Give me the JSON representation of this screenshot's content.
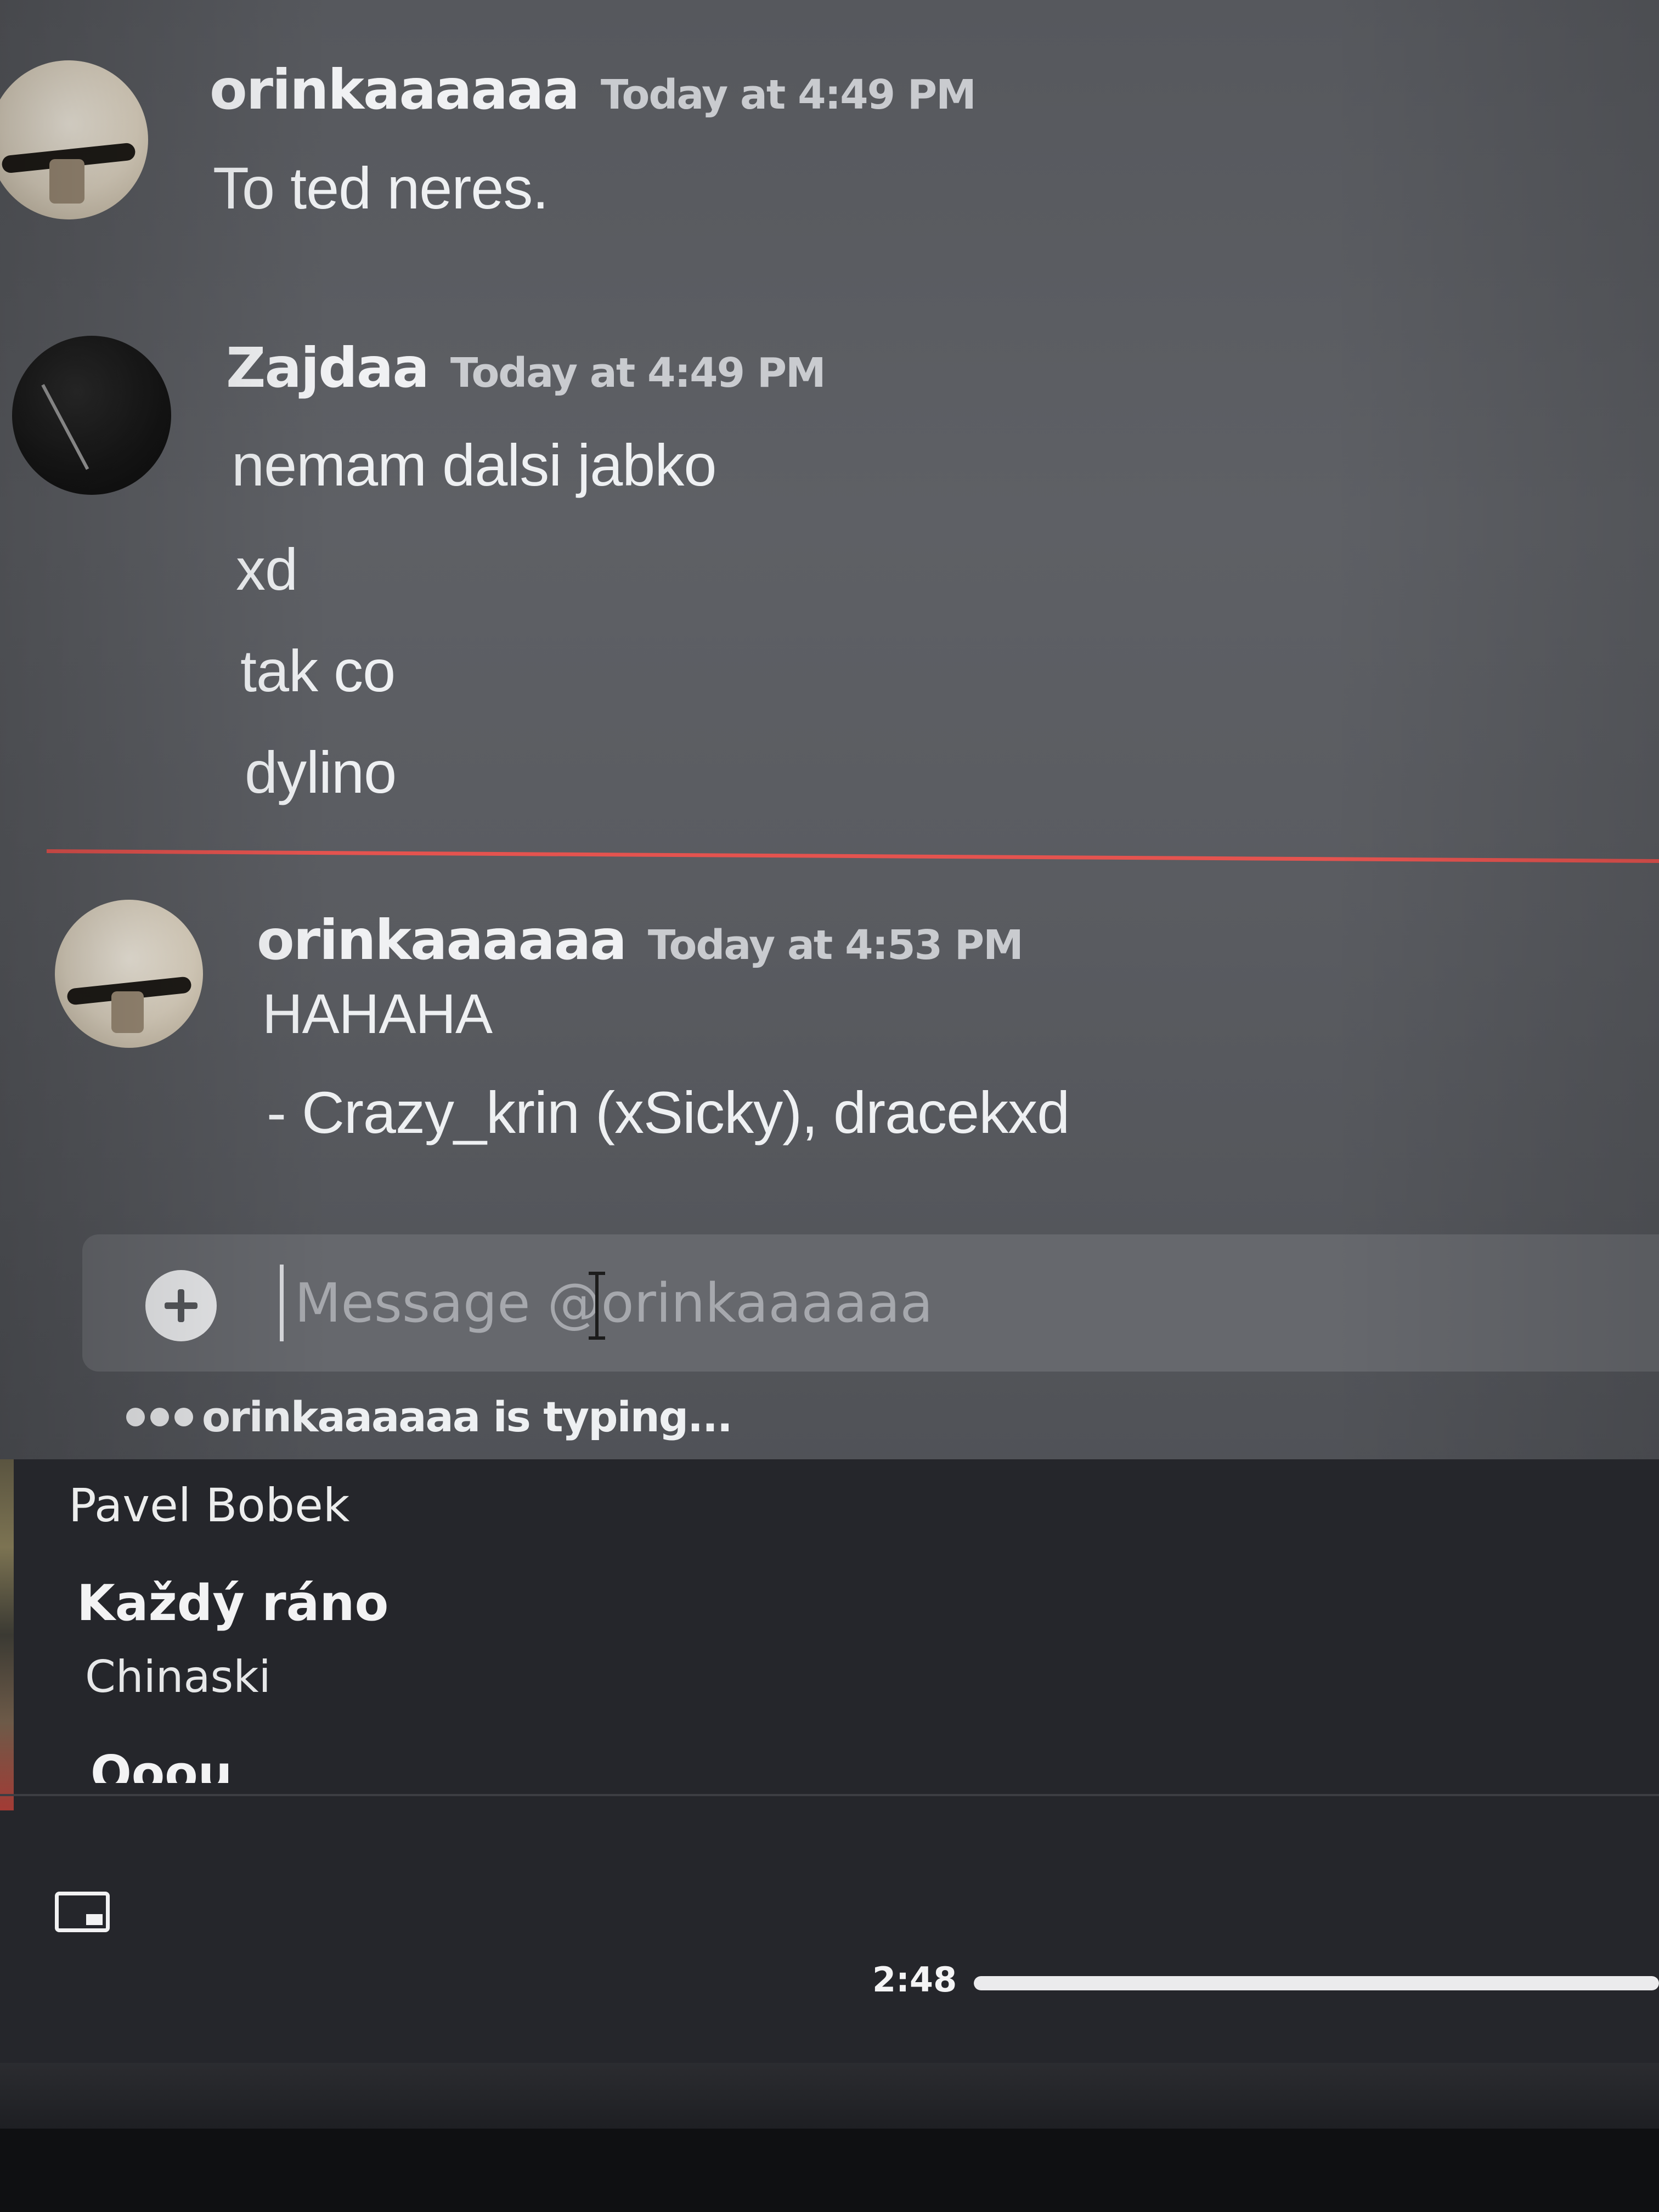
{
  "messages": [
    {
      "author": "orinkaaaaaa",
      "timestamp": "Today at 4:49 PM",
      "avatar": "cat-avatar",
      "lines": [
        "To ted neres."
      ]
    },
    {
      "author": "Zajdaa",
      "timestamp": "Today at 4:49 PM",
      "avatar": "flower-avatar",
      "lines": [
        "nemam dalsi jabko",
        "xd",
        "tak co",
        "dylino"
      ]
    },
    {
      "author": "orinkaaaaaa",
      "timestamp": "Today at 4:53 PM",
      "avatar": "cat-avatar",
      "lines": [
        "HAHAHA",
        "- Crazy_krin (xSicky), dracekxd"
      ]
    }
  ],
  "new_messages_divider_color": "#e4534f",
  "composer": {
    "placeholder": "Message @orinkaaaaaa",
    "value": "",
    "attach_icon": "plus-circle-icon"
  },
  "typing_indicator": {
    "text": "orinkaaaaaa is typing..."
  },
  "media_player": {
    "previous_artist": "Pavel Bobek",
    "current_title": "Každý ráno",
    "current_artist": "Chinaski",
    "next_title": "Ooou",
    "pip_icon": "picture-in-picture-icon",
    "elapsed": "2:48",
    "progress_fraction": 1.0
  }
}
